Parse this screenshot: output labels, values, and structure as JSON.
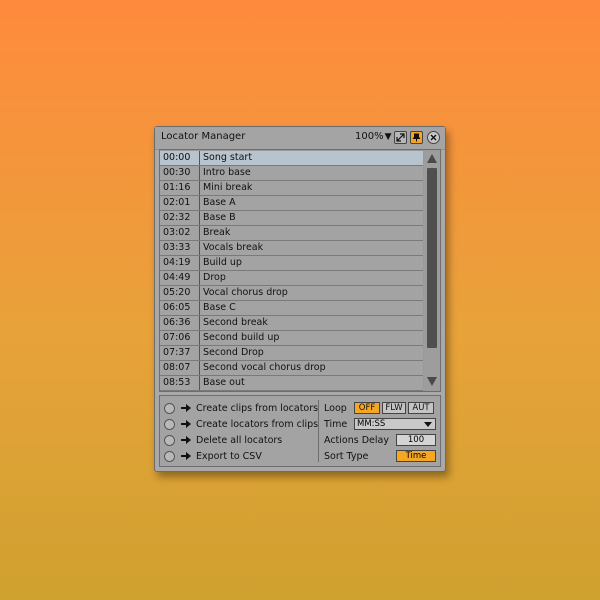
{
  "window": {
    "title": "Locator Manager",
    "zoom": "100%"
  },
  "locators": [
    {
      "time": "00:00",
      "name": "Song start",
      "selected": true
    },
    {
      "time": "00:30",
      "name": "Intro base"
    },
    {
      "time": "01:16",
      "name": "Mini break"
    },
    {
      "time": "02:01",
      "name": "Base A"
    },
    {
      "time": "02:32",
      "name": "Base B"
    },
    {
      "time": "03:02",
      "name": "Break"
    },
    {
      "time": "03:33",
      "name": "Vocals break"
    },
    {
      "time": "04:19",
      "name": "Build up"
    },
    {
      "time": "04:49",
      "name": "Drop"
    },
    {
      "time": "05:20",
      "name": "Vocal chorus drop"
    },
    {
      "time": "06:05",
      "name": "Base C"
    },
    {
      "time": "06:36",
      "name": "Second break"
    },
    {
      "time": "07:06",
      "name": "Second build up"
    },
    {
      "time": "07:37",
      "name": "Second Drop"
    },
    {
      "time": "08:07",
      "name": "Second vocal chorus drop"
    },
    {
      "time": "08:53",
      "name": "Base out"
    }
  ],
  "actions": [
    {
      "label": "Create clips from locators"
    },
    {
      "label": "Create locators from clips"
    },
    {
      "label": "Delete all locators"
    },
    {
      "label": "Export to CSV"
    }
  ],
  "settings": {
    "loop_label": "Loop",
    "loop_off": "OFF",
    "loop_flw": "FLW",
    "loop_aut": "AUT",
    "loop_selected": "OFF",
    "time_label": "Time",
    "time_format": "MM:SS",
    "delay_label": "Actions Delay",
    "delay_value": "100",
    "sort_label": "Sort Type",
    "sort_value": "Time"
  },
  "colors": {
    "accent": "#f5a623",
    "selected_row": "#b7c3cd",
    "panel": "#a9a9a9"
  },
  "icons": {
    "expand": "expand-icon",
    "pin": "pin-icon",
    "close": "close-icon",
    "arrow": "arrow-right-icon"
  }
}
